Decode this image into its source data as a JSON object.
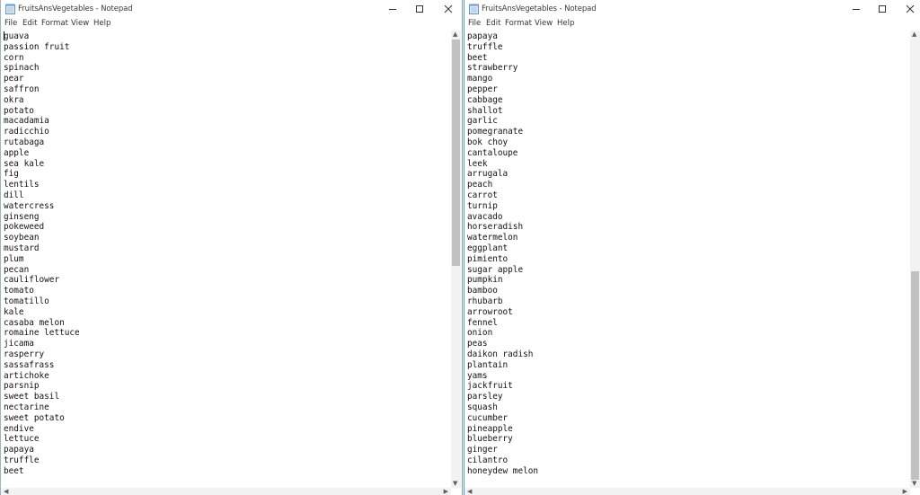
{
  "left": {
    "title": "FruitsAnsVegetables - Notepad",
    "menu": [
      "File",
      "Edit",
      "Format",
      "View",
      "Help"
    ],
    "lines": [
      "guava",
      "passion fruit",
      "corn",
      "spinach",
      "pear",
      "saffron",
      "okra",
      "potato",
      "macadamia",
      "radicchio",
      "rutabaga",
      "apple",
      "sea kale",
      "fig",
      "lentils",
      "dill",
      "watercress",
      "ginseng",
      "pokeweed",
      "soybean",
      "mustard",
      "plum",
      "pecan",
      "cauliflower",
      "tomato",
      "tomatillo",
      "kale",
      "casaba melon",
      "romaine lettuce",
      "jicama",
      "rasperry",
      "sassafrass",
      "artichoke",
      "parsnip",
      "sweet basil",
      "nectarine",
      "sweet potato",
      "endive",
      "lettuce",
      "papaya",
      "truffle",
      "beet"
    ]
  },
  "right": {
    "title": "FruitsAnsVegetables - Notepad",
    "menu": [
      "File",
      "Edit",
      "Format",
      "View",
      "Help"
    ],
    "lines": [
      "papaya",
      "truffle",
      "beet",
      "strawberry",
      "mango",
      "pepper",
      "cabbage",
      "shallot",
      "garlic",
      "pomegranate",
      "bok choy",
      "cantaloupe",
      "leek",
      "arrugala",
      "peach",
      "carrot",
      "turnip",
      "avacado",
      "horseradish",
      "watermelon",
      "eggplant",
      "pimiento",
      "sugar apple",
      "pumpkin",
      "bamboo",
      "rhubarb",
      "arrowroot",
      "fennel",
      "onion",
      "peas",
      "daikon radish",
      "plantain",
      "yams",
      "jackfruit",
      "parsley",
      "squash",
      "cucumber",
      "pineapple",
      "blueberry",
      "ginger",
      "cilantro",
      "honeydew melon"
    ]
  },
  "icons": {
    "minimize": "minimize-icon",
    "maximize": "maximize-icon",
    "close": "close-icon",
    "scroll_up": "scroll-up-arrow-icon",
    "scroll_down": "scroll-down-arrow-icon",
    "scroll_left": "scroll-left-arrow-icon",
    "scroll_right": "scroll-right-arrow-icon"
  }
}
